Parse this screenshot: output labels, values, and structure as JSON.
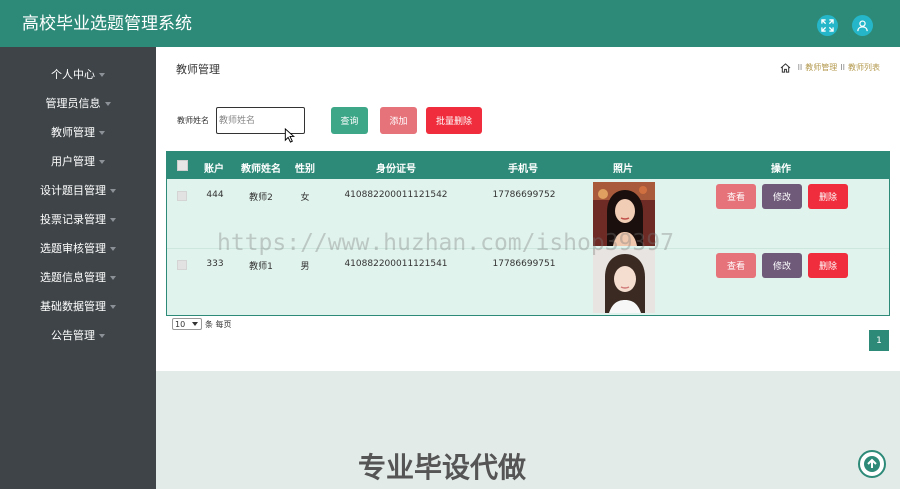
{
  "app": {
    "title": "高校毕业选题管理系统"
  },
  "icons": {
    "fullscreen": "expand-icon",
    "user": "user-icon",
    "home": "home-icon",
    "back_to_top": "arrow-up-circle-icon"
  },
  "colors": {
    "brand": "#2d8a78",
    "sidebar": "#3e4448",
    "query": "#3ea787",
    "add": "#e6727a",
    "danger": "#ef2d3c",
    "edit": "#6f5a7a",
    "icon_circle": "#25b7c9"
  },
  "sidebar": {
    "items": [
      {
        "label": "个人中心"
      },
      {
        "label": "管理员信息"
      },
      {
        "label": "教师管理"
      },
      {
        "label": "用户管理"
      },
      {
        "label": "设计题目管理"
      },
      {
        "label": "投票记录管理"
      },
      {
        "label": "选题审核管理"
      },
      {
        "label": "选题信息管理"
      },
      {
        "label": "基础数据管理"
      },
      {
        "label": "公告管理"
      }
    ]
  },
  "page": {
    "heading": "教师管理",
    "breadcrumb": {
      "sep": "II",
      "level1": "教师管理",
      "level2": "教师列表"
    }
  },
  "search": {
    "label": "教师姓名",
    "placeholder": "教师姓名",
    "value": "",
    "query_label": "查询",
    "add_label": "添加",
    "batch_delete_label": "批量删除"
  },
  "table": {
    "headers": {
      "account": "账户",
      "name": "教师姓名",
      "gender": "性别",
      "id_card": "身份证号",
      "phone": "手机号",
      "photo": "照片",
      "actions": "操作"
    },
    "rows": [
      {
        "account": "444",
        "name": "教师2",
        "gender": "女",
        "id_card": "410882200011121542",
        "phone": "17786699752",
        "photo": "portrait-photo"
      },
      {
        "account": "333",
        "name": "教师1",
        "gender": "男",
        "id_card": "410882200011121541",
        "phone": "17786699751",
        "photo": "portrait-photo"
      }
    ],
    "action_labels": {
      "view": "查看",
      "edit": "修改",
      "delete": "删除"
    }
  },
  "pagination": {
    "page_size": "10",
    "page_size_suffix": "条 每页",
    "current_page": "1"
  },
  "watermark": {
    "url": "https://www.huzhan.com/ishop39397",
    "ad": "专业毕设代做"
  }
}
